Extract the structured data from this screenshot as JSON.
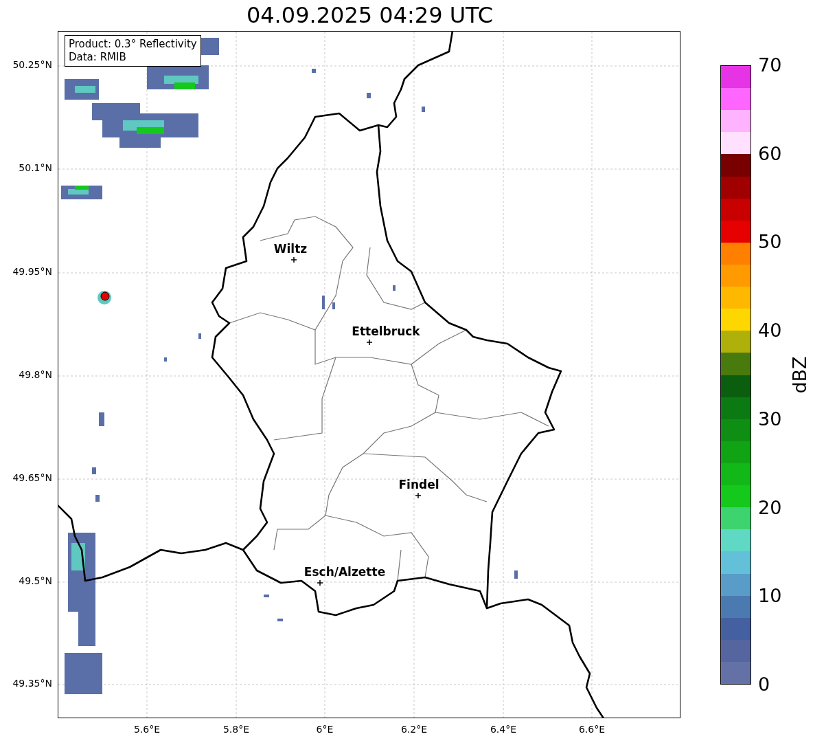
{
  "title": "04.09.2025 04:29 UTC",
  "legend": {
    "lines": [
      "Product: 0.3° Reflectivity",
      "Data: RMIB"
    ]
  },
  "cities": [
    {
      "name": "Wiltz"
    },
    {
      "name": "Ettelbruck"
    },
    {
      "name": "Findel"
    },
    {
      "name": "Esch/Alzette"
    }
  ],
  "y_axis": {
    "ticks": [
      "50.25°N",
      "50.1°N",
      "49.95°N",
      "49.8°N",
      "49.65°N",
      "49.5°N",
      "49.35°N"
    ]
  },
  "x_axis": {
    "ticks": [
      "5.6°E",
      "5.8°E",
      "6°E",
      "6.2°E",
      "6.4°E",
      "6.6°E"
    ]
  },
  "colorbar": {
    "label": "dBZ",
    "ticks": [
      "70",
      "60",
      "50",
      "40",
      "30",
      "20",
      "10",
      "0"
    ],
    "segments": [
      {
        "color": "#6471a6"
      },
      {
        "color": "#5565a0"
      },
      {
        "color": "#4460a0"
      },
      {
        "color": "#4a7ab0"
      },
      {
        "color": "#5a9cc8"
      },
      {
        "color": "#62c0d8"
      },
      {
        "color": "#5fd8c4"
      },
      {
        "color": "#3dd36e"
      },
      {
        "color": "#14c81c"
      },
      {
        "color": "#12b818"
      },
      {
        "color": "#10a414"
      },
      {
        "color": "#0f8e14"
      },
      {
        "color": "#0b7a12"
      },
      {
        "color": "#0a5e0e"
      },
      {
        "color": "#487a0e"
      },
      {
        "color": "#b0b00a"
      },
      {
        "color": "#ffd700"
      },
      {
        "color": "#ffb800"
      },
      {
        "color": "#ff9a00"
      },
      {
        "color": "#ff7f00"
      },
      {
        "color": "#e60000"
      },
      {
        "color": "#c80000"
      },
      {
        "color": "#a00000"
      },
      {
        "color": "#780000"
      },
      {
        "color": "#ffe0ff"
      },
      {
        "color": "#ffb3ff"
      },
      {
        "color": "#ff66ff"
      },
      {
        "color": "#e633e6"
      }
    ]
  }
}
